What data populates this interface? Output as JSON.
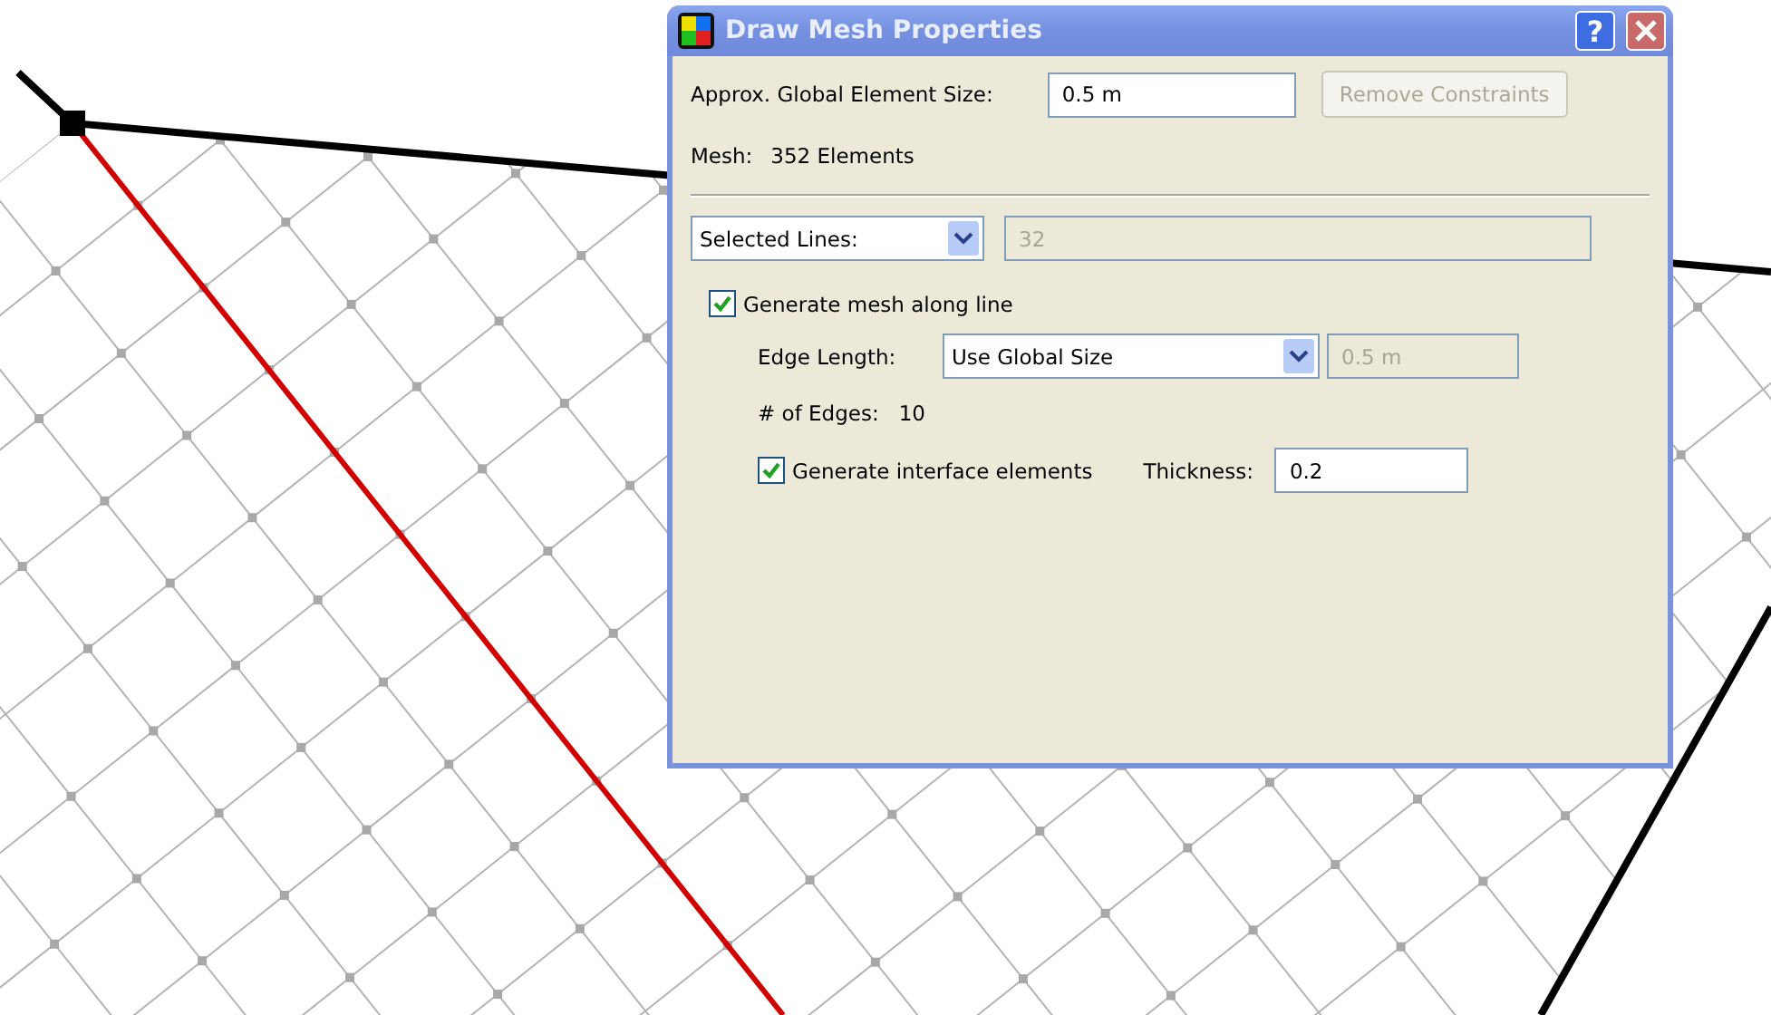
{
  "window": {
    "title": "Draw Mesh Properties",
    "help": "?"
  },
  "global_size": {
    "label": "Approx. Global Element Size:",
    "value": "0.5 m"
  },
  "remove_button": {
    "label": "Remove Constraints",
    "disabled": true
  },
  "mesh_info": {
    "label": "Mesh:",
    "value": "352 Elements"
  },
  "selection": {
    "dropdown": "Selected Lines:",
    "count": "32"
  },
  "generate_mesh": {
    "label": "Generate mesh along line",
    "checked": true
  },
  "edge_length": {
    "label": "Edge Length:",
    "dropdown": "Use Global Size",
    "value": "0.5 m"
  },
  "edges": {
    "label": "# of Edges:",
    "value": "10"
  },
  "interface": {
    "label": "Generate interface elements",
    "checked": true,
    "thickness_label": "Thickness:",
    "thickness": "0.2"
  }
}
